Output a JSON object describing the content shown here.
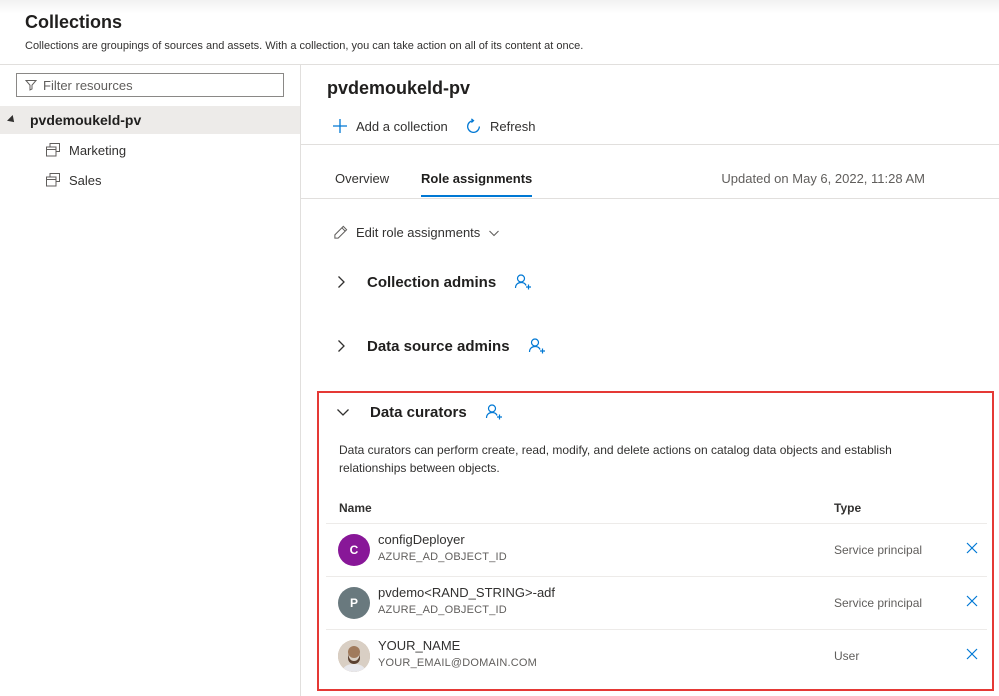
{
  "header": {
    "title": "Collections",
    "subtitle": "Collections are groupings of sources and assets. With a collection, you can take action on all of its content at once."
  },
  "sidebar": {
    "filter_placeholder": "Filter resources",
    "root": "pvdemoukeld-pv",
    "children": [
      "Marketing",
      "Sales"
    ]
  },
  "main": {
    "title": "pvdemoukeld-pv",
    "toolbar": {
      "add_label": "Add a collection",
      "refresh_label": "Refresh"
    },
    "tabs": [
      "Overview",
      "Role assignments"
    ],
    "active_tab": "Role assignments",
    "updated": "Updated on May 6, 2022, 11:28 AM",
    "edit_label": "Edit role assignments",
    "sections": {
      "collection_admins": "Collection admins",
      "data_source_admins": "Data source admins",
      "data_curators": "Data curators"
    },
    "curators": {
      "description": "Data curators can perform create, read, modify, and delete actions on catalog data objects and establish relationships between objects.",
      "columns": {
        "name": "Name",
        "type": "Type"
      },
      "rows": [
        {
          "initial": "C",
          "name": "configDeployer",
          "id": "AZURE_AD_OBJECT_ID",
          "type": "Service principal",
          "color": "#881798"
        },
        {
          "initial": "P",
          "name": "pvdemo<RAND_STRING>-adf",
          "id": "AZURE_AD_OBJECT_ID",
          "type": "Service principal",
          "color": "#69797e"
        },
        {
          "initial": "",
          "name": "YOUR_NAME",
          "id": "YOUR_EMAIL@DOMAIN.COM",
          "type": "User",
          "color": "#c7ac94"
        }
      ]
    }
  },
  "colors": {
    "accent": "#0078d4",
    "highlight": "#e53935"
  }
}
